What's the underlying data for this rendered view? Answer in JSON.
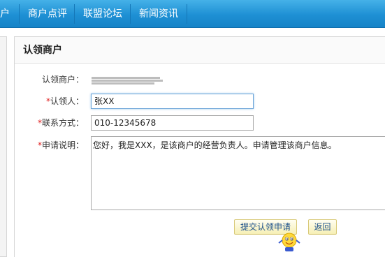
{
  "nav": {
    "items": [
      {
        "label": "户"
      },
      {
        "label": "商户点评"
      },
      {
        "label": "联盟论坛"
      },
      {
        "label": "新闻资讯"
      }
    ]
  },
  "panel": {
    "title": "认领商户"
  },
  "form": {
    "merchant_label": "认领商户：",
    "claimant_label": "认领人：",
    "claimant_value": "张XX",
    "contact_label": "联系方式：",
    "contact_value": "010-12345678",
    "note_label": "申请说明：",
    "note_value": "您好，我是XXX，是该商户的经营负责人。申请管理该商户信息。",
    "required_mark": "*"
  },
  "buttons": {
    "submit": "提交认领申请",
    "back": "返回"
  },
  "icons": {
    "mascot": "smiley-mascot-icon"
  },
  "colors": {
    "nav": "#1e90d4",
    "required": "#e02020",
    "button_bg": "#f6efb4"
  }
}
